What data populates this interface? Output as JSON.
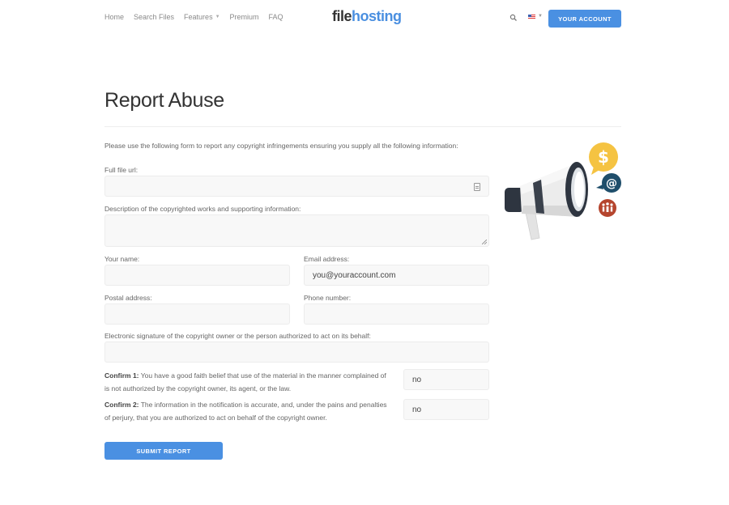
{
  "header": {
    "nav": [
      {
        "label": "Home"
      },
      {
        "label": "Search Files"
      },
      {
        "label": "Features"
      },
      {
        "label": "Premium"
      },
      {
        "label": "FAQ"
      }
    ],
    "logo_part1": "file",
    "logo_part2": "hosting",
    "account_button": "YOUR ACCOUNT"
  },
  "page": {
    "title": "Report Abuse",
    "intro": "Please use the following form to report any copyright infringements ensuring you supply all the following information:"
  },
  "form": {
    "file_url": {
      "label": "Full file url:",
      "value": ""
    },
    "description": {
      "label": "Description of the copyrighted works and supporting information:",
      "value": ""
    },
    "name": {
      "label": "Your name:",
      "value": ""
    },
    "email": {
      "label": "Email address:",
      "value": "you@youraccount.com"
    },
    "postal": {
      "label": "Postal address:",
      "value": ""
    },
    "phone": {
      "label": "Phone number:",
      "value": ""
    },
    "signature": {
      "label": "Electronic signature of the copyright owner or the person authorized to act on its behalf:",
      "value": ""
    },
    "confirm1": {
      "title": "Confirm 1:",
      "text": "You have a good faith belief that use of the material in the manner complained of is not authorized by the copyright owner, its agent, or the law.",
      "value": "no"
    },
    "confirm2": {
      "title": "Confirm 2:",
      "text": "The information in the notification is accurate, and, under the pains and penalties of perjury, that you are authorized to act on behalf of the copyright owner.",
      "value": "no"
    },
    "submit": "SUBMIT REPORT"
  },
  "icons": [
    "search-icon",
    "us-flag-icon",
    "clipboard-icon",
    "megaphone-illustration",
    "dollar-bubble-icon",
    "at-bubble-icon",
    "people-bubble-icon"
  ],
  "colors": {
    "accent": "#4a90e2",
    "logo_blue": "#4a8fe0",
    "coin": "#f5c342",
    "at_bubble": "#1f4e6b",
    "people_bubble": "#b5452e"
  }
}
